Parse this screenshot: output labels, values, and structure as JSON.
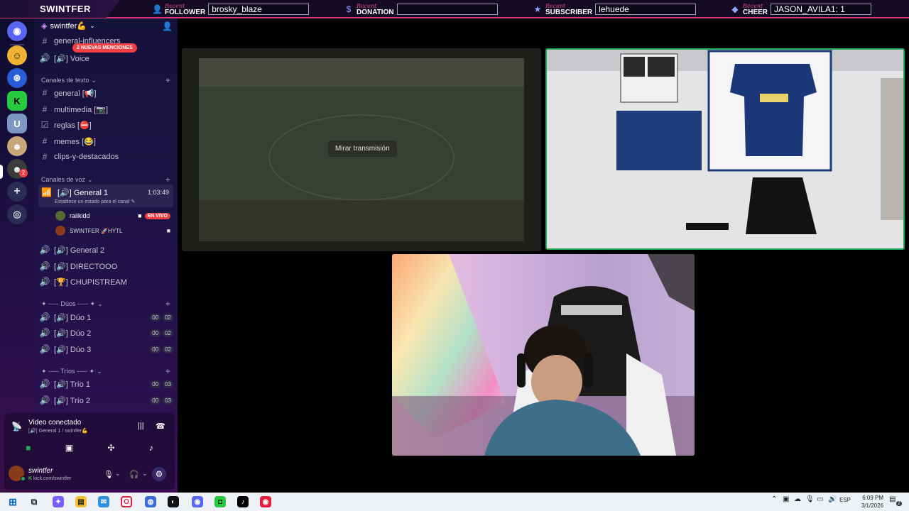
{
  "overlay": {
    "brand": "SWINTFER",
    "recent_label": "Recent",
    "follower": {
      "type": "FOLLOWER",
      "value": "brosky_blaze"
    },
    "donation": {
      "type": "DONATION",
      "value": ""
    },
    "subscriber": {
      "type": "SUBSCRIBER",
      "value": "lehuede"
    },
    "cheer": {
      "type": "CHEER",
      "value": "JASON_AVILA1: 1"
    }
  },
  "servers": [
    {
      "name": "discord-home-icon",
      "color": "#5865f2",
      "glyph": "◉"
    },
    {
      "name": "server-emoji",
      "color": "#f0b232",
      "glyph": "☺"
    },
    {
      "name": "server-logo",
      "color": "#2c5bd6",
      "glyph": "⊛"
    },
    {
      "name": "server-kick",
      "color": "#27c93f",
      "glyph": "K"
    },
    {
      "name": "server-ud",
      "color": "#7f95c4",
      "glyph": "U"
    },
    {
      "name": "server-person",
      "color": "#c7a67a",
      "glyph": "☻"
    },
    {
      "name": "server-active",
      "color": "#3b3b3b",
      "glyph": "☻",
      "badge": "2"
    }
  ],
  "rail_actions": {
    "add": "+",
    "discover": "◎"
  },
  "sidebar": {
    "server_name": "swintfer💪",
    "mentions_badge": "2 NUEVAS MENCIONES",
    "top_channels": [
      {
        "name": "general-influencers",
        "type": "text"
      },
      {
        "name": "[🔊] Voice",
        "type": "voice"
      }
    ],
    "text_category": "Canales de texto",
    "text_channels": [
      {
        "name": "general [📢]",
        "icon": "#"
      },
      {
        "name": "multimedia [📷]",
        "icon": "#"
      },
      {
        "name": "reglas [⛔]",
        "icon": "☑"
      },
      {
        "name": "memes [😂]",
        "icon": "#"
      },
      {
        "name": "clips-y-destacados",
        "icon": "#"
      }
    ],
    "voice_category": "Canales de voz",
    "active_voice": {
      "name": "[🔊] General 1",
      "time": "1:03:49",
      "status_hint": "Establece un estado para el canal",
      "members": [
        {
          "name": "raiikidd",
          "live": "EN VIVO"
        },
        {
          "name": "SWINTFER 🚀HYTL",
          "live": ""
        }
      ]
    },
    "voice_channels": [
      {
        "name": "[🔊] General 2"
      },
      {
        "name": "[🔊] DIRECTOOO"
      },
      {
        "name": "[🏆] CHUPISTREAM"
      }
    ],
    "duos_category": "✦ ----- Dúos ----- ✦",
    "duos": [
      {
        "name": "[🔊] Dúo 1",
        "a": "00",
        "b": "02"
      },
      {
        "name": "[🔊] Dúo 2",
        "a": "00",
        "b": "02"
      },
      {
        "name": "[🔊] Dúo 3",
        "a": "00",
        "b": "02"
      }
    ],
    "trios_category": "✦ ----- Tríos ----- ✦",
    "trios": [
      {
        "name": "[🔊] Trío 1",
        "a": "00",
        "b": "03"
      },
      {
        "name": "[🔊] Trío 2",
        "a": "00",
        "b": "03"
      }
    ]
  },
  "voice_panel": {
    "status": "Video conectado",
    "location": "[🔊] General 1 / swintfer💪"
  },
  "user_panel": {
    "username": "swintfer",
    "subtitle": "kick.com/swintfer"
  },
  "main": {
    "watch_stream_label": "Mirar transmisión"
  },
  "taskbar": {
    "language": "ESP",
    "time": "6:09 PM",
    "date": "3/1/2026",
    "notifications": "2"
  }
}
